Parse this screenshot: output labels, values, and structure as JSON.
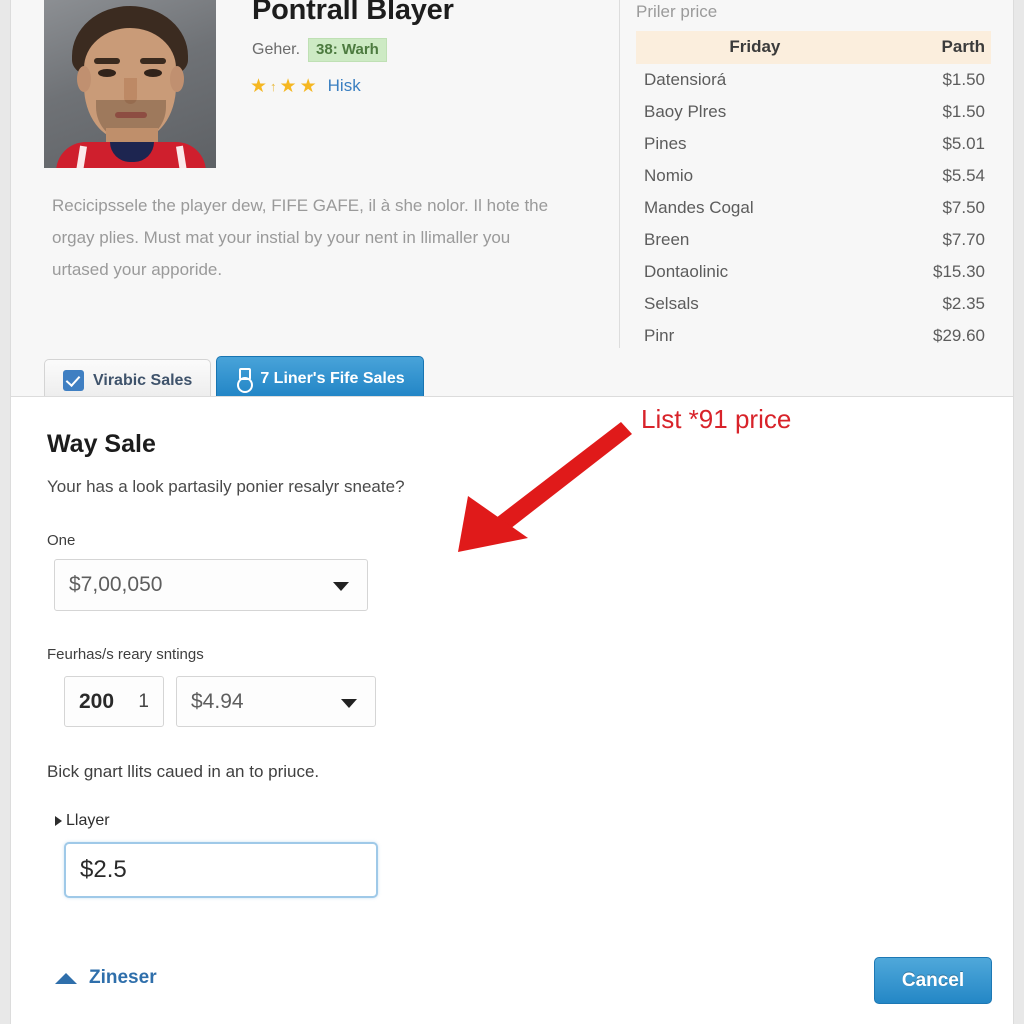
{
  "profile": {
    "title": "Pontrall Blayer",
    "gender_label": "Geher.",
    "badge": "38: Warh",
    "rating_link": "Hisk",
    "stars": [
      "★",
      "↑",
      "★",
      "★"
    ],
    "description": "Recicipssele the player dew, FIFE GAFE, il à she nolor. Il hote the orgay plies. Must mat your instial by your nent in llimaller you urtased your apporide."
  },
  "tabs": [
    {
      "label": "Virabic Sales",
      "icon": "check-square-icon",
      "active": false
    },
    {
      "label": "7 Liner's Fife Sales",
      "icon": "medal-icon",
      "active": true
    }
  ],
  "price_panel": {
    "title": "Priler price",
    "columns": [
      "Friday",
      "Parth"
    ],
    "rows": [
      {
        "name": "Datensiorá",
        "value": "$1.50"
      },
      {
        "name": "Baoy Plres",
        "value": "$1.50"
      },
      {
        "name": "Pines",
        "value": "$5.01"
      },
      {
        "name": "Nomio",
        "value": "$5.54"
      },
      {
        "name": "Mandes Cogal",
        "value": "$7.50"
      },
      {
        "name": "Breen",
        "value": "$7.70"
      },
      {
        "name": "Dontaolinic",
        "value": "$15.30"
      },
      {
        "name": "Selsals",
        "value": "$2.35"
      },
      {
        "name": "Pinr",
        "value": "$29.60"
      }
    ]
  },
  "dialog": {
    "title": "Way Sale",
    "subtitle": "Your has a look partasily ponier resalyr sneate?",
    "field_one_label": "One",
    "field_one_value": "$7,00,050",
    "field_two_label": "Feurhas/s reary sntings",
    "quantity_value": "200",
    "quantity_unit": "1",
    "price_value": "$4.94",
    "note": "Bick gnart llits caued in an to priuce.",
    "sub_label": "Llayer",
    "focus_value": "$2.5",
    "collapse_label": "Zineser",
    "cancel_label": "Cancel"
  },
  "annotation": {
    "text": "List *91 price",
    "color": "#d8232a"
  }
}
